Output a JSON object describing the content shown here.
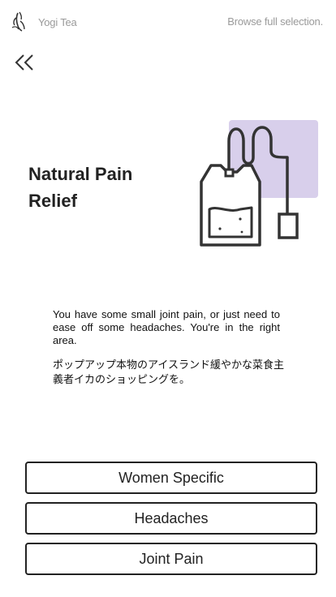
{
  "header": {
    "brand": "Yogi Tea",
    "browse_link": "Browse full selection."
  },
  "back_icon": "double-chevron-left-icon",
  "main": {
    "title": "Natural Pain Relief",
    "description": "You have some small joint pain, or just need to ease off some headaches. You're in the right area.",
    "description_ja": "ポップアップ本物のアイスランド緩やかな菜食主義者イカのショッピングを。"
  },
  "illustration": {
    "icon": "tea-bag-icon",
    "accent_color": "#d8cfeb"
  },
  "options": [
    {
      "label": "Women Specific"
    },
    {
      "label": "Headaches"
    },
    {
      "label": "Joint Pain"
    }
  ]
}
